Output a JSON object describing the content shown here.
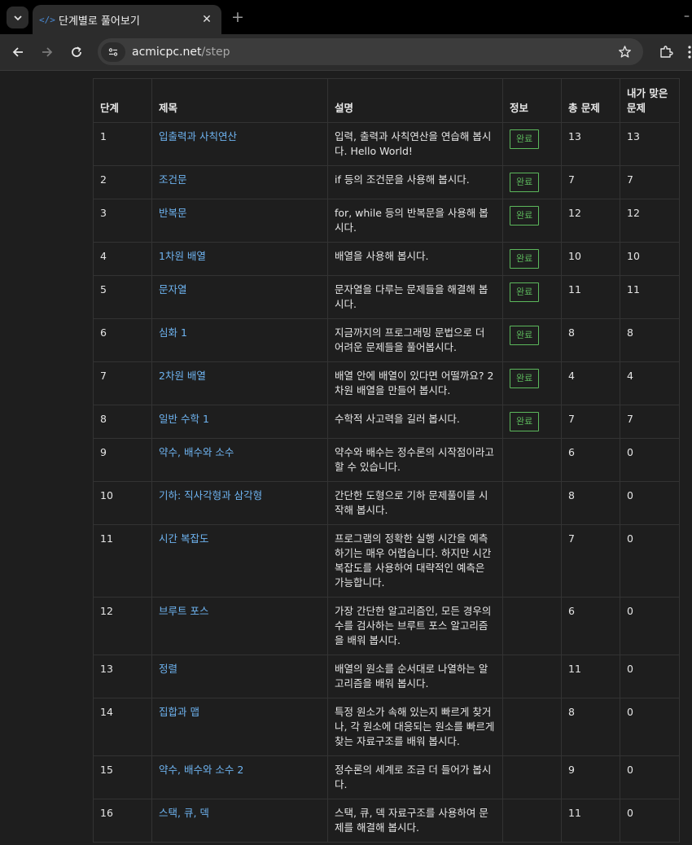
{
  "browser": {
    "tab_title": "단계별로 풀어보기",
    "tab_favicon": "</>",
    "url_host": "acmicpc.net",
    "url_path": "/step",
    "new_tab_symbol": "+",
    "close_symbol": "✕",
    "minimize_symbol": "–"
  },
  "table": {
    "headers": {
      "step": "단계",
      "title": "제목",
      "desc": "설명",
      "info": "정보",
      "total": "총 문제",
      "solved": "내가 맞은 문제"
    },
    "rows": [
      {
        "step": "1",
        "title": "입출력과 사칙연산",
        "desc": "입력, 출력과 사칙연산을 연습해 봅시다. Hello World!",
        "badge": "완료",
        "total": "13",
        "solved": "13"
      },
      {
        "step": "2",
        "title": "조건문",
        "desc": "if 등의 조건문을 사용해 봅시다.",
        "badge": "완료",
        "total": "7",
        "solved": "7"
      },
      {
        "step": "3",
        "title": "반복문",
        "desc": "for, while 등의 반복문을 사용해 봅시다.",
        "badge": "완료",
        "total": "12",
        "solved": "12"
      },
      {
        "step": "4",
        "title": "1차원 배열",
        "desc": "배열을 사용해 봅시다.",
        "badge": "완료",
        "total": "10",
        "solved": "10"
      },
      {
        "step": "5",
        "title": "문자열",
        "desc": "문자열을 다루는 문제들을 해결해 봅시다.",
        "badge": "완료",
        "total": "11",
        "solved": "11"
      },
      {
        "step": "6",
        "title": "심화 1",
        "desc": "지금까지의 프로그래밍 문법으로 더 어려운 문제들을 풀어봅시다.",
        "badge": "완료",
        "total": "8",
        "solved": "8"
      },
      {
        "step": "7",
        "title": "2차원 배열",
        "desc": "배열 안에 배열이 있다면 어떨까요? 2차원 배열을 만들어 봅시다.",
        "badge": "완료",
        "total": "4",
        "solved": "4"
      },
      {
        "step": "8",
        "title": "일반 수학 1",
        "desc": "수학적 사고력을 길러 봅시다.",
        "badge": "완료",
        "total": "7",
        "solved": "7"
      },
      {
        "step": "9",
        "title": "약수, 배수와 소수",
        "desc": "약수와 배수는 정수론의 시작점이라고 할 수 있습니다.",
        "badge": "",
        "total": "6",
        "solved": "0"
      },
      {
        "step": "10",
        "title": "기하: 직사각형과 삼각형",
        "desc": "간단한 도형으로 기하 문제풀이를 시작해 봅시다.",
        "badge": "",
        "total": "8",
        "solved": "0"
      },
      {
        "step": "11",
        "title": "시간 복잡도",
        "desc": "프로그램의 정확한 실행 시간을 예측하기는 매우 어렵습니다. 하지만 시간 복잡도를 사용하여 대략적인 예측은 가능합니다.",
        "badge": "",
        "total": "7",
        "solved": "0"
      },
      {
        "step": "12",
        "title": "브루트 포스",
        "desc": "가장 간단한 알고리즘인, 모든 경우의 수를 검사하는 브루트 포스 알고리즘을 배워 봅시다.",
        "badge": "",
        "total": "6",
        "solved": "0"
      },
      {
        "step": "13",
        "title": "정렬",
        "desc": "배열의 원소를 순서대로 나열하는 알고리즘을 배워 봅시다.",
        "badge": "",
        "total": "11",
        "solved": "0"
      },
      {
        "step": "14",
        "title": "집합과 맵",
        "desc": "특정 원소가 속해 있는지 빠르게 찾거나, 각 원소에 대응되는 원소를 빠르게 찾는 자료구조를 배워 봅시다.",
        "badge": "",
        "total": "8",
        "solved": "0"
      },
      {
        "step": "15",
        "title": "약수, 배수와 소수 2",
        "desc": "정수론의 세계로 조금 더 들어가 봅시다.",
        "badge": "",
        "total": "9",
        "solved": "0"
      },
      {
        "step": "16",
        "title": "스택, 큐, 덱",
        "desc": "스택, 큐, 덱 자료구조를 사용하여 문제를 해결해 봅시다.",
        "badge": "",
        "total": "11",
        "solved": "0"
      }
    ]
  },
  "colors": {
    "link": "#6eb3f0",
    "badge": "#5cb85c",
    "background": "#1e1e1e",
    "border": "#333333"
  }
}
